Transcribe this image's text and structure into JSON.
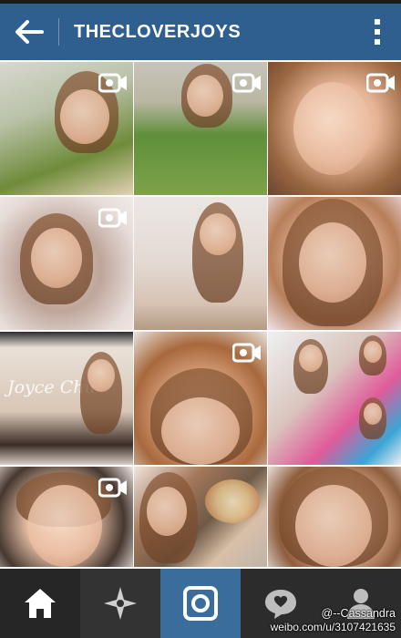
{
  "header": {
    "title": "THECLOVERJOYS",
    "back_icon": "arrow-left-icon",
    "menu_icon": "more-vertical-icon",
    "bar_color": "#2f5f8e"
  },
  "grid": {
    "tiles": [
      {
        "kind": "video"
      },
      {
        "kind": "video"
      },
      {
        "kind": "video"
      },
      {
        "kind": "video"
      },
      {
        "kind": "photo"
      },
      {
        "kind": "photo"
      },
      {
        "kind": "photo",
        "overlay_text": "Joyce Chu"
      },
      {
        "kind": "video"
      },
      {
        "kind": "photo"
      },
      {
        "kind": "video"
      },
      {
        "kind": "photo"
      },
      {
        "kind": "photo"
      }
    ]
  },
  "bottom_nav": {
    "items": [
      "home-icon",
      "explore-star-icon",
      "camera-icon",
      "activity-bubble-icon",
      "profile-icon"
    ],
    "active": "camera-icon",
    "active_color": "#3a6d9c"
  },
  "watermark": {
    "name": "@--Cassandra",
    "url": "weibo.com/u/3107421635"
  }
}
